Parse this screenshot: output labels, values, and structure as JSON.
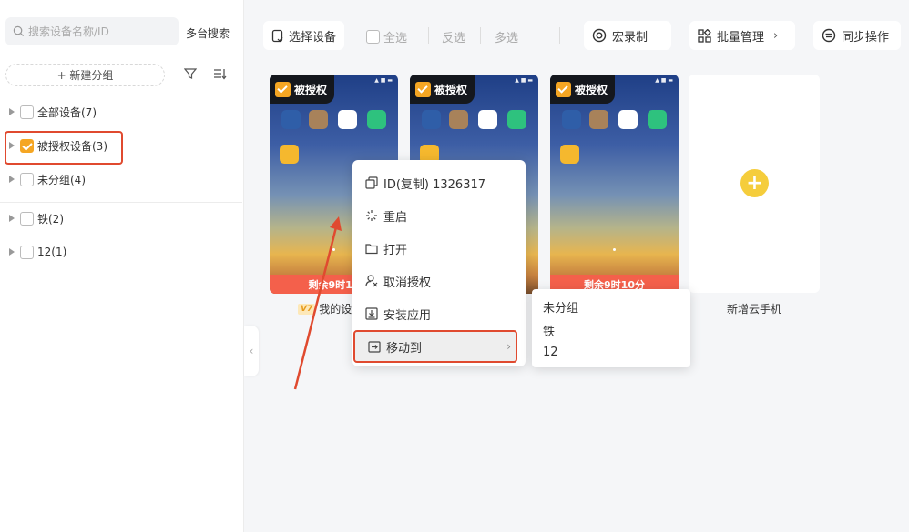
{
  "sidebar": {
    "search_placeholder": "搜索设备名称/ID",
    "multi_search": "多台搜索",
    "new_group": "+ 新建分组",
    "groups": [
      {
        "label": "全部设备(7)",
        "checked": false
      },
      {
        "label": "被授权设备(3)",
        "checked": true
      },
      {
        "label": "未分组(4)",
        "checked": false
      },
      {
        "label": "铁(2)",
        "checked": false
      },
      {
        "label": "12(1)",
        "checked": false
      }
    ],
    "collapse_glyph": "‹"
  },
  "toolbar": {
    "select_device": "选择设备",
    "select_all": "全选",
    "invert": "反选",
    "multi_select": "多选",
    "macro": "宏录制",
    "batch_manage": "批量管理",
    "sync": "同步操作"
  },
  "cards": [
    {
      "badge": "被授权",
      "remain": "剩余9时18",
      "name": "我的设"
    },
    {
      "badge": "被授权",
      "remain": "",
      "name": ""
    },
    {
      "badge": "被授权",
      "remain": "剩余9时10分",
      "name": ""
    }
  ],
  "vip_label": "V7",
  "add_card": {
    "label": "新增云手机",
    "plus": "+"
  },
  "context_menu": {
    "items": [
      "ID(复制) 1326317",
      "重启",
      "打开",
      "取消授权",
      "安装应用",
      "移动到"
    ],
    "submenu_arrow": "›"
  },
  "submenu": {
    "items": [
      "未分组",
      "铁",
      "12"
    ]
  },
  "colors": {
    "accent": "#f5a623",
    "highlight": "#e04a2f",
    "remain_bar": "#f4604b"
  },
  "icons": [
    "search-icon",
    "filter-icon",
    "sort-icon",
    "macro-icon",
    "batch-grid-icon",
    "sync-icon",
    "copy-icon",
    "restart-icon",
    "folder-icon",
    "user-x-icon",
    "install-icon",
    "move-icon",
    "plus-icon"
  ]
}
